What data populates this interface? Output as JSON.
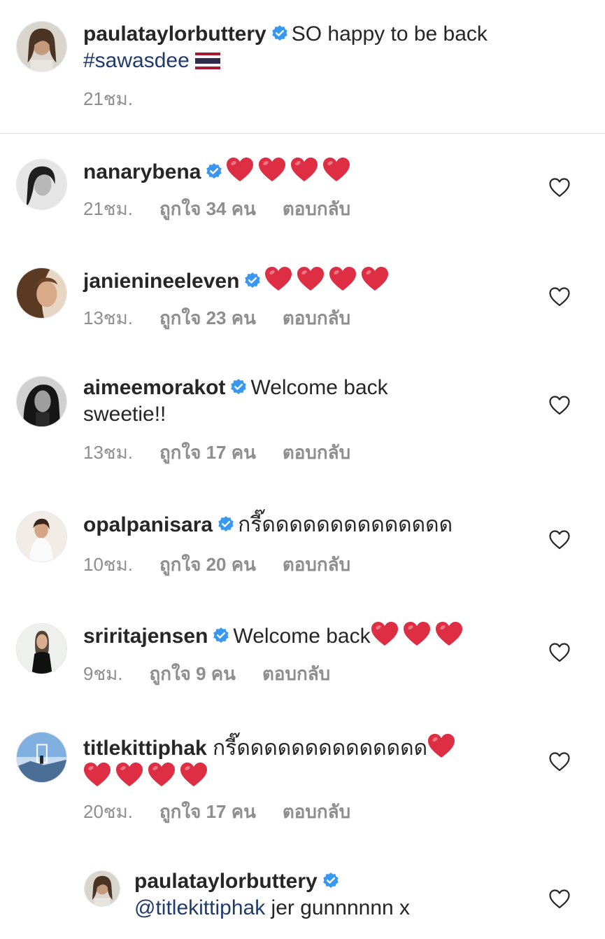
{
  "post": {
    "username": "paulataylorbuttery",
    "caption": "SO happy to be back",
    "hashtag": "#sawasdee",
    "time": "21ชม."
  },
  "comments": [
    {
      "username": "nanarybena",
      "text": "",
      "hearts": 4,
      "time": "21ชม.",
      "likes": "ถูกใจ 34 คน",
      "reply": "ตอบกลับ"
    },
    {
      "username": "janienineeleven",
      "text": "",
      "hearts": 4,
      "time": "13ชม.",
      "likes": "ถูกใจ 23 คน",
      "reply": "ตอบกลับ"
    },
    {
      "username": "aimeemorakot",
      "text": "Welcome back",
      "text2": "sweetie!!",
      "time": "13ชม.",
      "likes": "ถูกใจ 17 คน",
      "reply": "ตอบกลับ"
    },
    {
      "username": "opalpanisara",
      "text": "กรี๊ดดดดดดดดดดดดดด",
      "time": "10ชม.",
      "likes": "ถูกใจ 20 คน",
      "reply": "ตอบกลับ"
    },
    {
      "username": "sriritajensen",
      "text": "Welcome back",
      "hearts": 3,
      "time": "9ชม.",
      "likes": "ถูกใจ 9 คน",
      "reply": "ตอบกลับ"
    },
    {
      "username": "titlekittiphak",
      "text": "กรี๊ดดดดดดดดดดดดดด",
      "hearts": 5,
      "time": "20ชม.",
      "likes": "ถูกใจ 17 คน",
      "reply": "ตอบกลับ"
    }
  ],
  "reply": {
    "username": "paulataylorbuttery",
    "mention": "@titlekittiphak",
    "text": "jer gunnnnnn x"
  },
  "colors": {
    "verified": "#3897f0",
    "hashtag": "#1f3b6e",
    "meta": "#8e8e8e",
    "heart": "#dd2e44"
  },
  "icons": {
    "verified": "verified-badge-icon",
    "like": "heart-outline-icon",
    "flag": "thailand-flag-icon"
  }
}
